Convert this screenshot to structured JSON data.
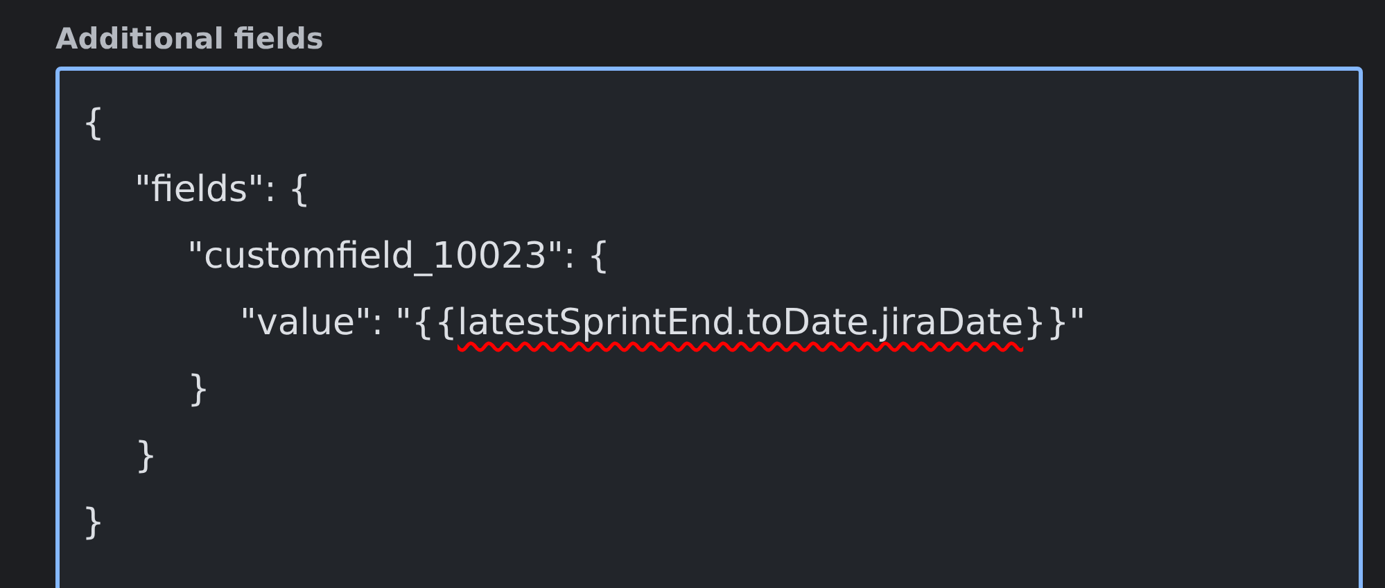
{
  "field": {
    "label": "Additional fields",
    "focused": true,
    "lines": [
      {
        "segments": [
          {
            "text": "{",
            "misspelled": false
          }
        ]
      },
      {
        "segments": [
          {
            "text": "\t\"fields\": {",
            "misspelled": false
          }
        ]
      },
      {
        "segments": [
          {
            "text": "\t\t\"customfield_10023\": {",
            "misspelled": false
          }
        ]
      },
      {
        "segments": [
          {
            "text": "\t\t\t\"value\": \"{{",
            "misspelled": false
          },
          {
            "text": "latestSprintEnd.toDate.jiraDate",
            "misspelled": true
          },
          {
            "text": "}}\"",
            "misspelled": false
          }
        ]
      },
      {
        "segments": [
          {
            "text": "\t\t}",
            "misspelled": false
          }
        ]
      },
      {
        "segments": [
          {
            "text": "\t}",
            "misspelled": false
          }
        ]
      },
      {
        "segments": [
          {
            "text": "}",
            "misspelled": false
          }
        ]
      }
    ]
  }
}
